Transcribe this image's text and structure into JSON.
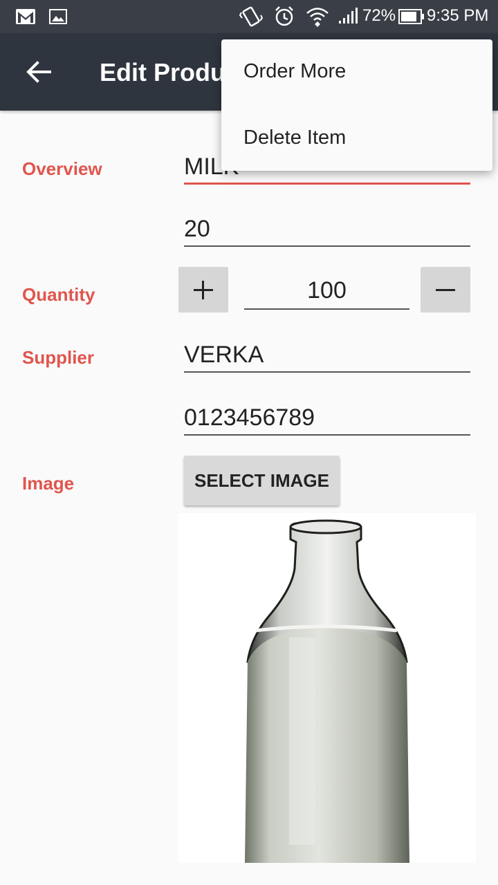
{
  "status_bar": {
    "battery_percent": "72%",
    "time": "9:35 PM",
    "icons": [
      "gmail-icon",
      "gallery-icon",
      "vibrate-icon",
      "alarm-icon",
      "wifi-icon",
      "signal-icon",
      "battery-icon"
    ]
  },
  "app_bar": {
    "title": "Edit Produ",
    "back_icon": "arrow-back-icon"
  },
  "menu": {
    "items": [
      {
        "label": "Order More"
      },
      {
        "label": "Delete Item"
      }
    ]
  },
  "form": {
    "overview_label": "Overview",
    "name_value": "MILK",
    "price_value": "20",
    "quantity_label": "Quantity",
    "quantity_value": "100",
    "supplier_label": "Supplier",
    "supplier_name_value": "VERKA",
    "supplier_phone_value": "0123456789",
    "image_label": "Image",
    "select_image_button": "SELECT IMAGE"
  },
  "colors": {
    "accent": "#e0554d",
    "app_bar": "#2f353e",
    "status_bar": "#3a3f47",
    "background": "#fafafa"
  }
}
